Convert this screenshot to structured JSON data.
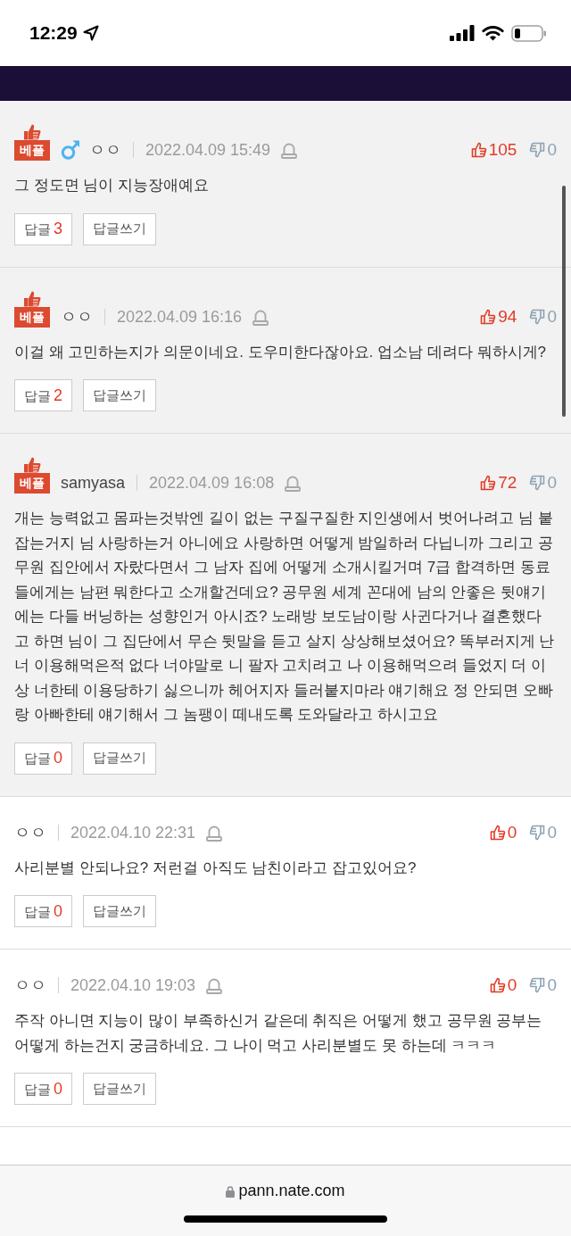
{
  "status_bar": {
    "time": "12:29"
  },
  "comments": [
    {
      "best": true,
      "badge": "베플",
      "male_icon": true,
      "author": "ㅇㅇ",
      "date": "2022.04.09 15:49",
      "likes": "105",
      "dislikes": "0",
      "text": "그 정도면 님이 지능장애예요",
      "reply_label": "답글",
      "reply_count": "3",
      "write_label": "답글쓰기"
    },
    {
      "best": true,
      "badge": "베플",
      "author": "ㅇㅇ",
      "date": "2022.04.09 16:16",
      "likes": "94",
      "dislikes": "0",
      "text": "이걸 왜 고민하는지가 의문이네요. 도우미한다잖아요. 업소남 데려다 뭐하시게?",
      "reply_label": "답글",
      "reply_count": "2",
      "write_label": "답글쓰기"
    },
    {
      "best": true,
      "badge": "베플",
      "author": "samyasa",
      "date": "2022.04.09 16:08",
      "likes": "72",
      "dislikes": "0",
      "text": "개는 능력없고 몸파는것밖엔 길이 없는 구질구질한 지인생에서 벗어나려고 님 붙잡는거지 님 사랑하는거 아니에요 사랑하면 어떻게 밤일하러 다닙니까 그리고 공무원 집안에서 자랐다면서 그 남자 집에 어떻게 소개시킬거며 7급 합격하면 동료들에게는 남편 뭐한다고 소개할건데요? 공무원 세계 꼰대에 남의 안좋은 뒷얘기에는 다들 버닝하는 성향인거 아시죠? 노래방 보도남이랑 사귄다거나 결혼했다고 하면 님이 그 집단에서 무슨 뒷말을 듣고 살지 상상해보셨어요? 똑부러지게 난 너 이용해먹은적 없다 너야말로 니 팔자 고치려고 나 이용해먹으려 들었지 더 이상 너한테 이용당하기 싫으니까 헤어지자 들러붙지마라 얘기해요 정 안되면 오빠랑 아빠한테 얘기해서 그 놈팽이 떼내도록 도와달라고 하시고요",
      "reply_label": "답글",
      "reply_count": "0",
      "write_label": "답글쓰기"
    },
    {
      "best": false,
      "author": "ㅇㅇ",
      "date": "2022.04.10 22:31",
      "likes": "0",
      "dislikes": "0",
      "text": "사리분별 안되나요? 저런걸 아직도 남친이라고 잡고있어요?",
      "reply_label": "답글",
      "reply_count": "0",
      "write_label": "답글쓰기"
    },
    {
      "best": false,
      "author": "ㅇㅇ",
      "date": "2022.04.10 19:03",
      "likes": "0",
      "dislikes": "0",
      "text": "주작 아니면 지능이 많이 부족하신거 같은데 취직은 어떻게 했고 공무원 공부는 어떻게 하는건지 궁금하네요. 그 나이 먹고 사리분별도 못 하는데 ㅋㅋㅋ",
      "reply_label": "답글",
      "reply_count": "0",
      "write_label": "답글쓰기"
    }
  ],
  "browser_bar": {
    "url": "pann.nate.com"
  }
}
